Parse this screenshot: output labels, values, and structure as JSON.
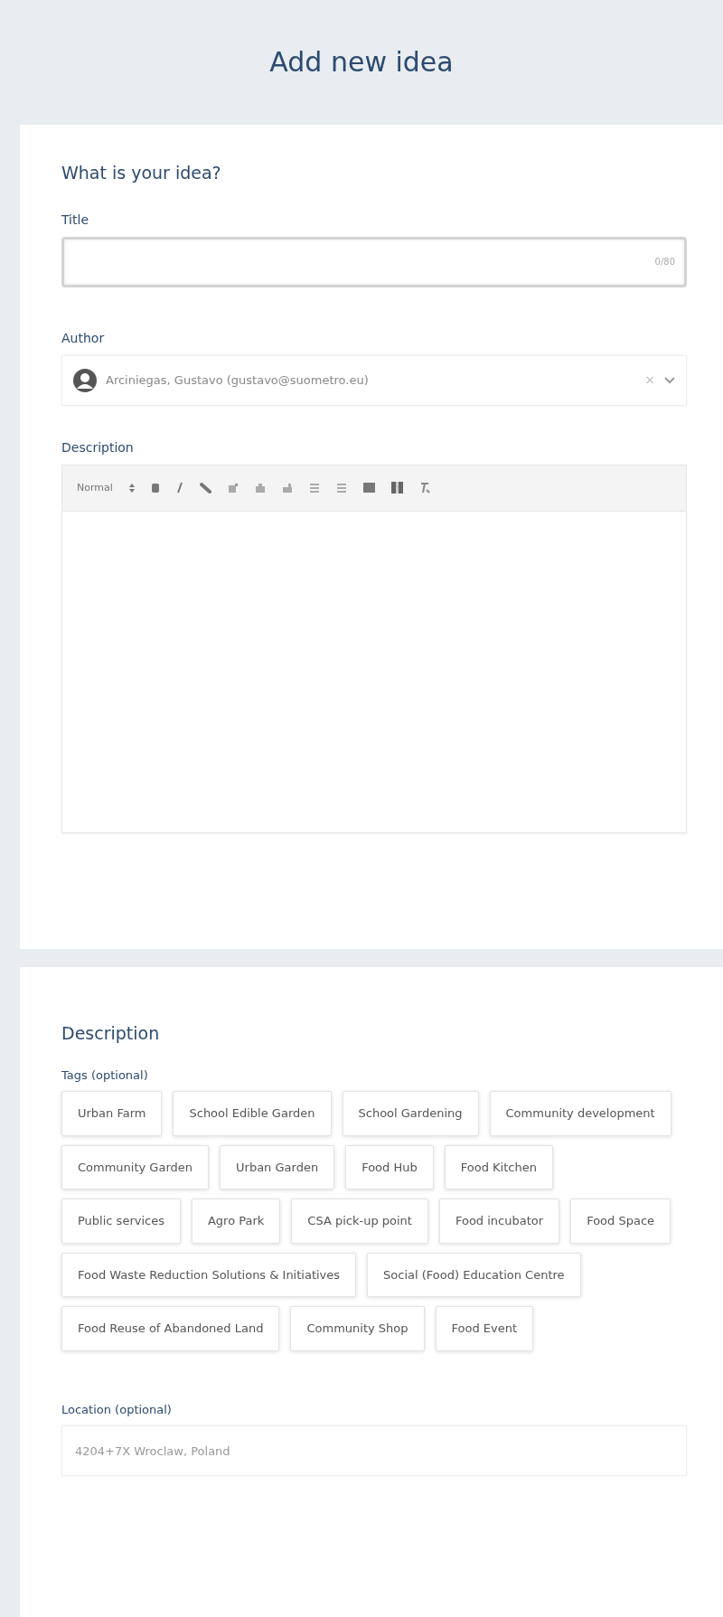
{
  "page_title": "Add new idea",
  "idea_section": {
    "heading": "What is your idea?",
    "title_field": {
      "label": "Title",
      "counter": "0/80"
    },
    "author_field": {
      "label": "Author",
      "value": "Arciniegas, Gustavo (gustavo@suometro.eu)",
      "clear": "×"
    },
    "description_field": {
      "label": "Description",
      "format": "Normal"
    }
  },
  "details_section": {
    "heading": "Description",
    "tags_label": "Tags (optional)",
    "tags": [
      {
        "label": "Urban Farm"
      },
      {
        "label": "School Edible Garden"
      },
      {
        "label": "School Gardening"
      },
      {
        "label": "Community development"
      },
      {
        "label": "Community Garden"
      },
      {
        "label": "Urban Garden"
      },
      {
        "label": "Food Hub"
      },
      {
        "label": "Food Kitchen"
      },
      {
        "label": "Public services"
      },
      {
        "label": "Agro Park"
      },
      {
        "label": "CSA pick-up point"
      },
      {
        "label": "Food incubator"
      },
      {
        "label": "Food Space"
      },
      {
        "label": "Food Waste Reduction Solutions & Initiatives"
      },
      {
        "label": "Social (Food) Education Centre"
      },
      {
        "label": "Food Reuse of Abandoned Land"
      },
      {
        "label": "Community Shop"
      },
      {
        "label": "Food Event"
      }
    ],
    "location_field": {
      "label": "Location (optional)",
      "placeholder": "4204+7X Wroclaw, Poland"
    }
  }
}
